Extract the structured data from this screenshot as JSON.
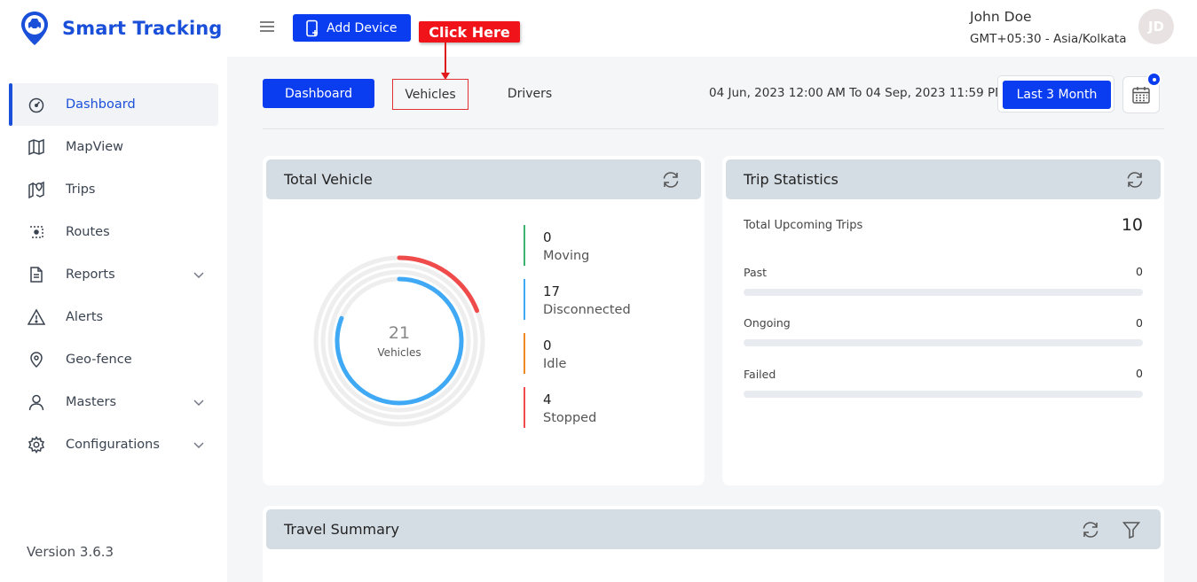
{
  "app": {
    "title": "Smart Tracking",
    "version": "Version 3.6.3"
  },
  "sidebar": {
    "items": [
      {
        "label": "Dashboard",
        "icon": "gauge-icon",
        "active": true,
        "expandable": false
      },
      {
        "label": "MapView",
        "icon": "map-icon",
        "active": false,
        "expandable": false
      },
      {
        "label": "Trips",
        "icon": "map-pin-icon",
        "active": false,
        "expandable": false
      },
      {
        "label": "Routes",
        "icon": "route-icon",
        "active": false,
        "expandable": false
      },
      {
        "label": "Reports",
        "icon": "document-icon",
        "active": false,
        "expandable": true
      },
      {
        "label": "Alerts",
        "icon": "warning-icon",
        "active": false,
        "expandable": false
      },
      {
        "label": "Geo-fence",
        "icon": "location-icon",
        "active": false,
        "expandable": false
      },
      {
        "label": "Masters",
        "icon": "user-icon",
        "active": false,
        "expandable": true
      },
      {
        "label": "Configurations",
        "icon": "gear-icon",
        "active": false,
        "expandable": true
      }
    ]
  },
  "header": {
    "add_device_label": "Add Device",
    "callout_label": "Click Here",
    "user_name": "John Doe",
    "timezone": "GMT+05:30 - Asia/Kolkata",
    "avatar_initials": "JD"
  },
  "tabs": [
    {
      "label": "Dashboard",
      "active": true
    },
    {
      "label": "Vehicles",
      "active": false,
      "highlighted": true
    },
    {
      "label": "Drivers",
      "active": false
    }
  ],
  "date_range": {
    "text": "04 Jun, 2023 12:00 AM To 04 Sep, 2023 11:59 PM",
    "preset_label": "Last 3 Month"
  },
  "total_vehicle": {
    "title": "Total Vehicle",
    "total": "21",
    "total_label": "Vehicles",
    "stats": [
      {
        "value": "0",
        "label": "Moving",
        "color": "#3cb371",
        "count": 0
      },
      {
        "value": "17",
        "label": "Disconnected",
        "color": "#3fa9f5",
        "count": 17
      },
      {
        "value": "0",
        "label": "Idle",
        "color": "#f08a24",
        "count": 0
      },
      {
        "value": "4",
        "label": "Stopped",
        "color": "#ef4b4b",
        "count": 4
      }
    ]
  },
  "trip_statistics": {
    "title": "Trip Statistics",
    "total_label": "Total Upcoming Trips",
    "total_value": "10",
    "rows": [
      {
        "label": "Past",
        "value": "0",
        "fraction": 0
      },
      {
        "label": "Ongoing",
        "value": "0",
        "fraction": 0
      },
      {
        "label": "Failed",
        "value": "0",
        "fraction": 0
      }
    ]
  },
  "travel_summary": {
    "title": "Travel Summary"
  },
  "colors": {
    "accent": "#0b3df0",
    "brand": "#1a4fd9",
    "callout": "#f0141a"
  }
}
